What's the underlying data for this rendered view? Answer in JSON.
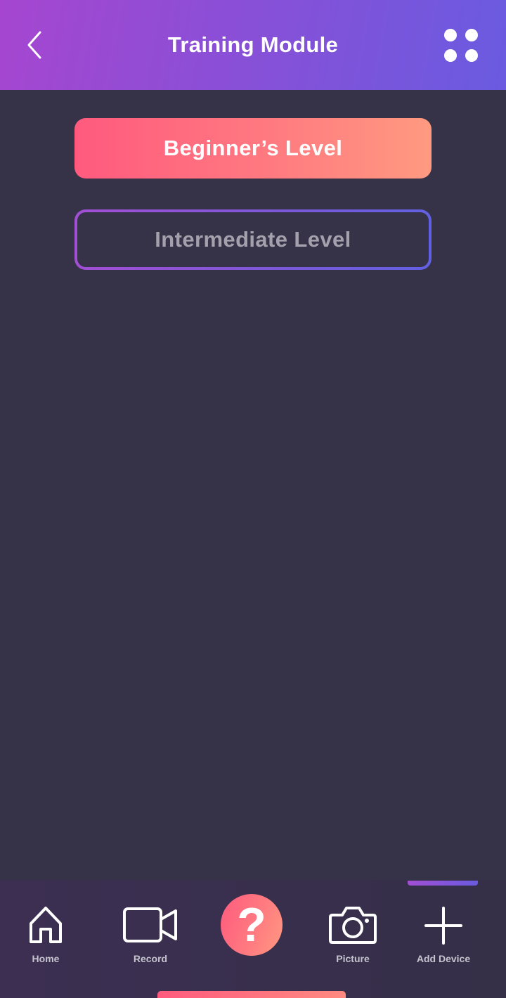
{
  "header": {
    "title": "Training Module",
    "back_icon": "chevron-left-icon",
    "menu_icon": "grid-dots-icon"
  },
  "levels": {
    "beginner_label": "Beginner’s Level",
    "intermediate_label": "Intermediate Level",
    "selected": "beginner"
  },
  "nav": {
    "items": [
      {
        "label": "Home",
        "icon": "home-icon"
      },
      {
        "label": "Record",
        "icon": "video-camera-icon"
      },
      {
        "label": "",
        "icon": "help-icon",
        "glyph": "?"
      },
      {
        "label": "Picture",
        "icon": "camera-icon"
      },
      {
        "label": "Add Device",
        "icon": "plus-icon"
      }
    ],
    "active": "Add Device"
  },
  "colors": {
    "background": "#363248",
    "header_gradient_start": "#a646d0",
    "header_gradient_end": "#6a5be0",
    "accent_pink": "#ff5a7e",
    "accent_peach": "#ff9a80",
    "muted_text": "#a4a1ad"
  }
}
